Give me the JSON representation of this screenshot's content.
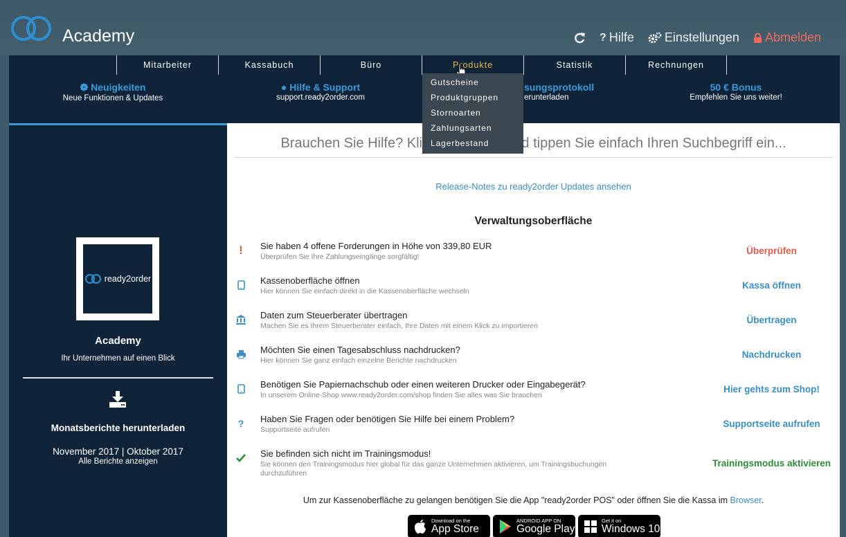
{
  "colors": {
    "accent": "#3a9bdc",
    "header_bg": "#3f5a6a",
    "panel_bg": "#0f2438",
    "active_tab": "#e6b847",
    "danger": "#e05a4a",
    "success": "#2e8b3a",
    "link": "#3a8fc4"
  },
  "header": {
    "app_title": "Academy",
    "actions": {
      "help": "Hilfe",
      "settings": "Einstellungen",
      "logout": "Abmelden"
    }
  },
  "nav": {
    "tabs": [
      "Mitarbeiter",
      "Kassabuch",
      "Büro",
      "Produkte",
      "Statistik",
      "Rechnungen"
    ],
    "active_tab": "Produkte",
    "dropdown": [
      "Gutscheine",
      "Produktgruppen",
      "Stornoarten",
      "Zahlungsarten",
      "Lagerbestand"
    ]
  },
  "infos": [
    {
      "title": "Neuigkeiten",
      "sub": "Neue Funktionen & Updates",
      "icon": "magic-wand-icon"
    },
    {
      "title": "Hilfe & Support",
      "sub": "support.ready2order.com",
      "icon": "globe-icon"
    },
    {
      "title": "sungsprotokoll",
      "sub": "erunterladen",
      "icon": ""
    },
    {
      "title": "50 € Bonus",
      "sub": "Empfehlen Sie uns weiter!",
      "icon": ""
    }
  ],
  "sidebar": {
    "logo_text": "ready2order",
    "company_name": "Academy",
    "company_tagline": "Ihr Unternehmen auf einen Blick",
    "reports_title": "Monatsberichte herunterladen",
    "reports_months": "November 2017 | Oktober 2017",
    "reports_all": "Alle Berichte anzeigen"
  },
  "main": {
    "search_placeholder": "Brauchen Sie Hilfe? Klicken Sie hier und tippen Sie einfach Ihren Suchbegriff ein...",
    "release_notes": "Release-Notes zu ready2order Updates ansehen",
    "section_title": "Verwaltungsoberfläche",
    "rows": [
      {
        "icon": "exclamation-icon",
        "title": "Sie haben 4 offene Forderungen in Höhe von 339,80 EUR",
        "sub": "Überprüfen Sie Ihre Zahlungseingänge sorgfältig!",
        "action": "Überprüfen",
        "color": "#e05a4a"
      },
      {
        "icon": "tablet-icon",
        "title": "Kassenoberfläche öffnen",
        "sub": "Hier können Sie einfach direkt in die Kassenoberfläche wechseln",
        "action": "Kassa öffnen",
        "color": "#3a8fc4"
      },
      {
        "icon": "bank-icon",
        "title": "Daten zum Steuerberater übertragen",
        "sub": "Machen Sie es Ihrem Steuerberater einfach, Ihre Daten mit einem Klick zu importieren",
        "action": "Übertragen",
        "color": "#3a8fc4"
      },
      {
        "icon": "printer-icon",
        "title": "Möchten Sie einen Tagesabschluss nachdrucken?",
        "sub": "Hier können Sie ganz einfach einzelne Berichte nachdrucken",
        "action": "Nachdrucken",
        "color": "#3a8fc4"
      },
      {
        "icon": "tablet-icon",
        "title": "Benötigen Sie Papiernachschub oder einen weiteren Drucker oder Eingabegerät?",
        "sub": "In unserem Online-Shop www.ready2order.com/shop finden Sie alles was Sie brauchen",
        "action": "Hier gehts zum Shop!",
        "color": "#3a8fc4"
      },
      {
        "icon": "question-icon",
        "title": "Haben Sie Fragen oder benötigen Sie Hilfe bei einem Problem?",
        "sub": "Supportseite aufrufen",
        "action": "Supportseite aufrufen",
        "color": "#3a8fc4"
      },
      {
        "icon": "check-icon",
        "title": "Sie befinden sich nicht im Trainingsmodus!",
        "sub": "Sie können den Trainingsmodus hier global für das ganze Unternehmen aktivieren, um Trainingsbuchungen durchzuführen",
        "action": "Trainingsmodus aktivieren",
        "color": "#2e8b3a"
      }
    ],
    "pos_note_text": "Um zur Kassenoberfläche zu gelangen benötigen Sie die App \"ready2order POS\" oder öffnen Sie die Kassa im ",
    "pos_note_link": "Browser",
    "pos_note_end": ".",
    "stores": [
      {
        "small": "Download on the",
        "large": "App Store",
        "icon": "apple-icon"
      },
      {
        "small": "ANDROID APP ON",
        "large": "Google Play",
        "icon": "google-play-icon"
      },
      {
        "small": "Get it on",
        "large": "Windows 10",
        "icon": "windows-icon"
      }
    ]
  }
}
